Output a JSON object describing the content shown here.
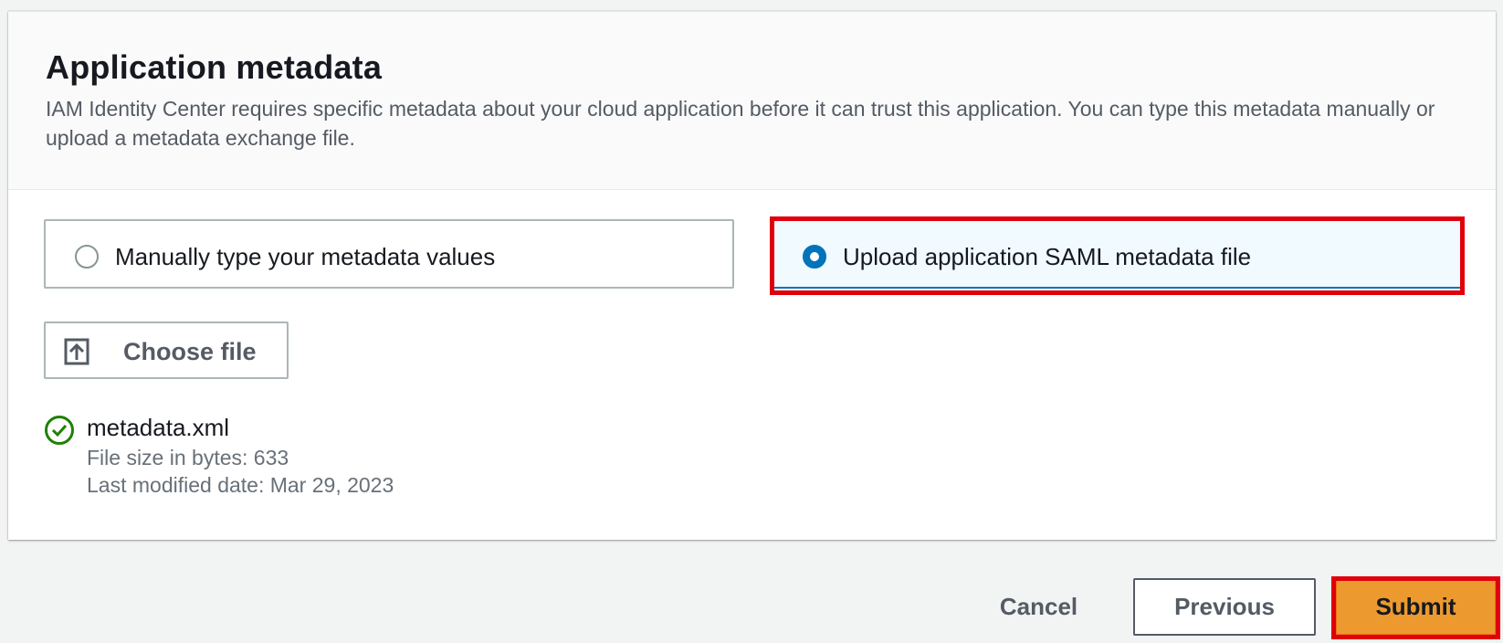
{
  "panel": {
    "title": "Application metadata",
    "description": "IAM Identity Center requires specific metadata about your cloud application before it can trust this application. You can type this metadata manually or upload a metadata exchange file."
  },
  "metadata_options": [
    {
      "label": "Manually type your metadata values",
      "selected": false
    },
    {
      "label": "Upload application SAML metadata file",
      "selected": true
    }
  ],
  "file_upload": {
    "button_label": "Choose file",
    "button_icon": "upload-icon"
  },
  "uploaded_file": {
    "name": "metadata.xml",
    "size": "File size in bytes: 633",
    "modified": "Last modified date: Mar 29, 2023",
    "status_icon": "success-check-icon"
  },
  "footer": {
    "cancel_label": "Cancel",
    "previous_label": "Previous",
    "submit_label": "Submit"
  },
  "colors": {
    "selected_radio": "#0073bb",
    "success": "#1d8102",
    "submit_bg": "#ec9a2f",
    "highlight": "#e0000b"
  }
}
